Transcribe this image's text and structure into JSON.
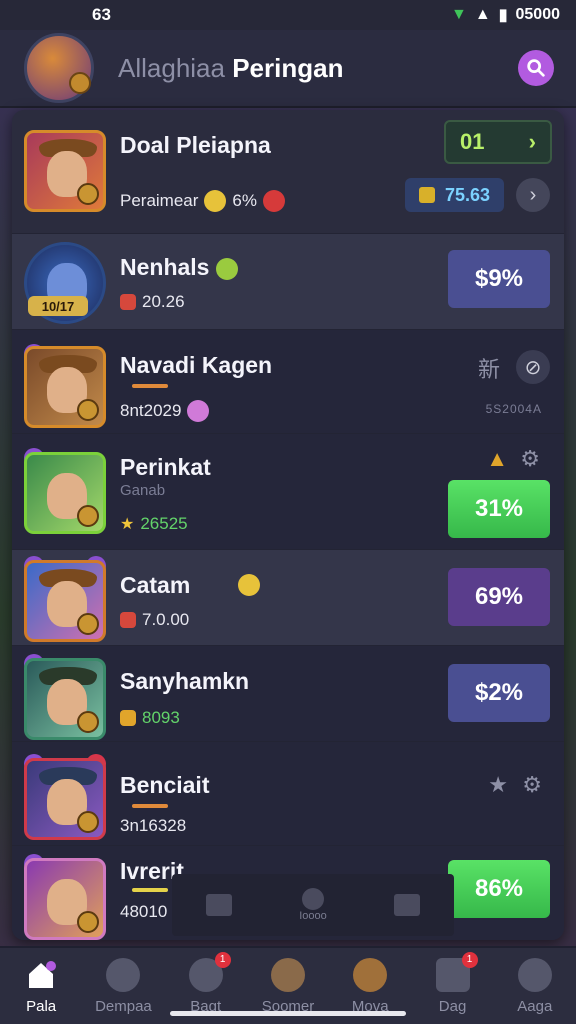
{
  "status": {
    "time": "63",
    "clock": "05000"
  },
  "header": {
    "title_dim": "Allaghiaa",
    "title_main": "Peringan"
  },
  "rows": [
    {
      "name": "Doal Pleiapna",
      "sub_label": "Peraimear",
      "sub_value": "6%",
      "pill1": "01",
      "pill2": "75.63"
    },
    {
      "name": "Nenhals",
      "sub_value": "20.26",
      "level": "10/17",
      "tag": "$9%"
    },
    {
      "name": "Navadi Kagen",
      "sub_value": "8nt2029",
      "muted": "5S2004A",
      "icon_label": "新"
    },
    {
      "name": "Perinkat",
      "sub_muted": "Ganab",
      "sub_value": "26525",
      "tag": "31%"
    },
    {
      "name": "Catam",
      "sub_value": "7.0.00",
      "tag": "69%"
    },
    {
      "name": "Sanyhamkn",
      "sub_value": "8093",
      "tag": "$2%"
    },
    {
      "name": "Benciait",
      "sub_value": "3n16328"
    },
    {
      "name": "Ivrerit",
      "sub_value": "48010",
      "tag": "86%"
    }
  ],
  "ghost": {
    "center_label": "Ioooo"
  },
  "tabs": [
    {
      "label": "Pala",
      "icon": "home-icon",
      "badge": ""
    },
    {
      "label": "Dempaa",
      "icon": "compass-icon",
      "badge": ""
    },
    {
      "label": "Bagt",
      "icon": "bag-icon",
      "badge": "1"
    },
    {
      "label": "Soomer",
      "icon": "hero-icon",
      "badge": ""
    },
    {
      "label": "Mova",
      "icon": "character-icon",
      "badge": ""
    },
    {
      "label": "Dag",
      "icon": "mail-icon",
      "badge": "1"
    },
    {
      "label": "Aaga",
      "icon": "profile-icon",
      "badge": ""
    }
  ],
  "colors": {
    "accent_purple": "#b25be0",
    "tag_green": "#4bd25a",
    "tag_blue": "#4a4f92"
  }
}
